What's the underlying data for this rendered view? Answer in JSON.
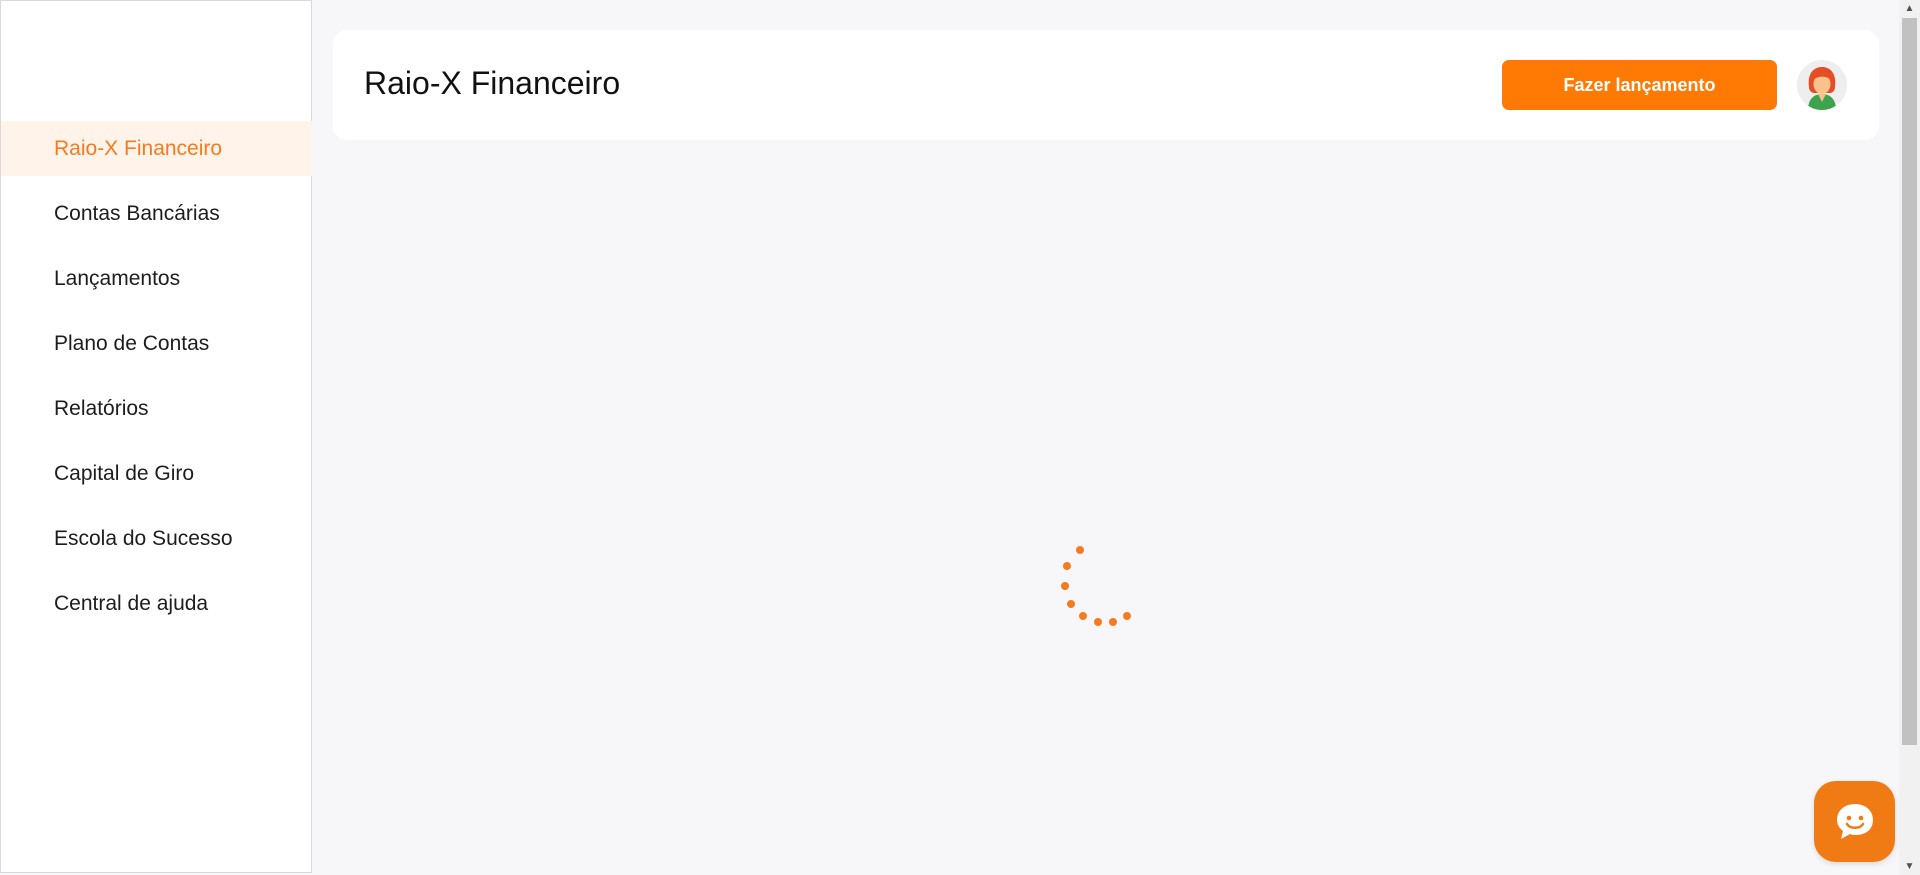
{
  "sidebar": {
    "items": [
      {
        "label": "Raio-X Financeiro",
        "active": true
      },
      {
        "label": "Contas Bancárias",
        "active": false
      },
      {
        "label": "Lançamentos",
        "active": false
      },
      {
        "label": "Plano de Contas",
        "active": false
      },
      {
        "label": "Relatórios",
        "active": false
      },
      {
        "label": "Capital de Giro",
        "active": false
      },
      {
        "label": "Escola do Sucesso",
        "active": false
      },
      {
        "label": "Central de ajuda",
        "active": false
      }
    ]
  },
  "header": {
    "title": "Raio-X Financeiro",
    "action_label": "Fazer lançamento",
    "avatar_icon": "user-avatar-icon"
  },
  "main": {
    "state": "loading",
    "spinner_icon": "loading-spinner-icon"
  },
  "chat": {
    "icon": "chat-bubble-icon"
  },
  "colors": {
    "accent": "#ff7a05",
    "active_bg": "#fff3ea",
    "active_text": "#f47b20",
    "background": "#f7f7f9"
  }
}
